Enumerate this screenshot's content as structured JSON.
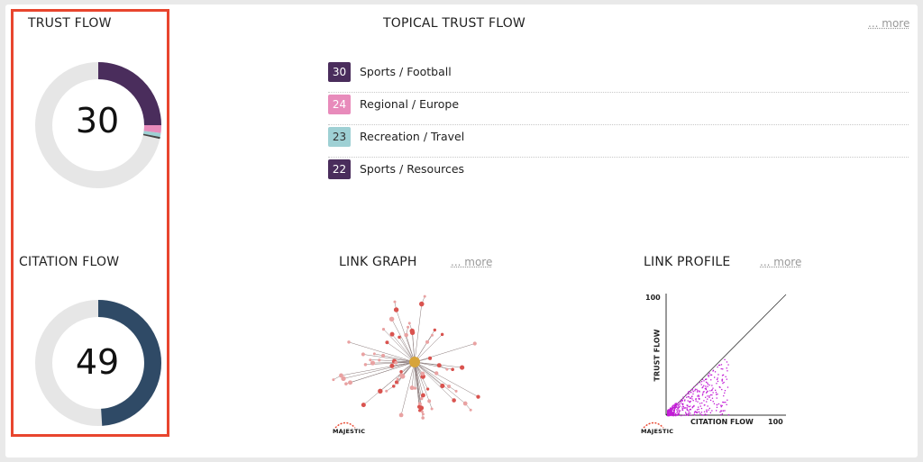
{
  "trust_flow": {
    "title": "TRUST FLOW",
    "value": "30",
    "fraction": 0.3,
    "color": "#4a2d5c",
    "segments": [
      {
        "color": "#4a2d5c",
        "fraction": 0.25
      },
      {
        "color": "#e88bbb",
        "fraction": 0.02
      },
      {
        "color": "#9ed0d4",
        "fraction": 0.01
      },
      {
        "color": "#444444",
        "fraction": 0.005
      }
    ]
  },
  "topical_trust_flow": {
    "title": "TOPICAL TRUST FLOW",
    "more_label": "... more",
    "items": [
      {
        "score": "30",
        "label": "Sports / Football",
        "color": "#4a2d5c"
      },
      {
        "score": "24",
        "label": "Regional / Europe",
        "color": "#e88bbb"
      },
      {
        "score": "23",
        "label": "Recreation / Travel",
        "color": "#9ed0d4"
      },
      {
        "score": "22",
        "label": "Sports / Resources",
        "color": "#4a2d5c"
      }
    ]
  },
  "citation_flow": {
    "title": "CITATION FLOW",
    "value": "49",
    "fraction": 0.49,
    "color": "#2f4a66"
  },
  "link_graph": {
    "title": "LINK GRAPH",
    "more_label": "... more",
    "logo_text": "MAJESTIC"
  },
  "link_profile": {
    "title": "LINK PROFILE",
    "more_label": "... more",
    "y_label": "TRUST FLOW",
    "x_label": "CITATION FLOW",
    "y_max_label": "100",
    "x_max_label": "100",
    "logo_text": "MAJESTIC",
    "point_color": "#c21bd6"
  },
  "colors": {
    "highlight_border": "#e8452e",
    "donut_track": "#e6e6e6"
  }
}
